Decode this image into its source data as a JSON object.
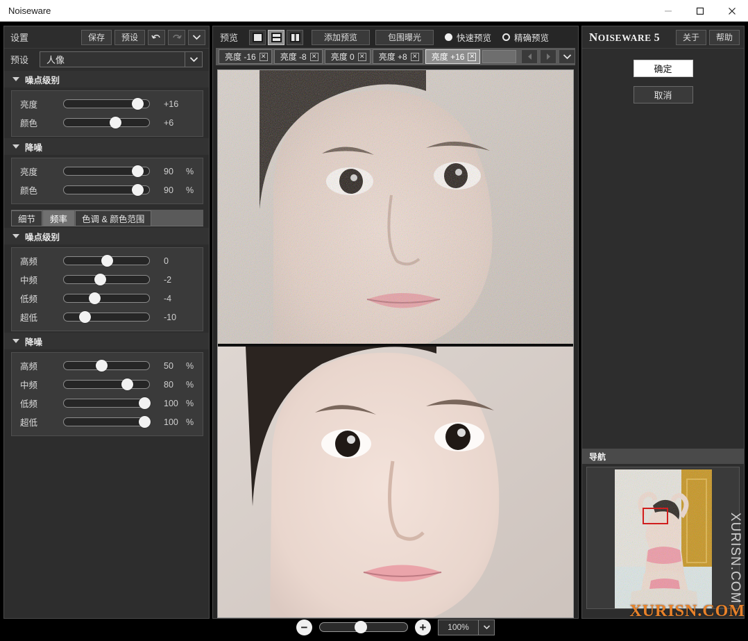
{
  "window": {
    "title": "Noiseware",
    "controls": {
      "minimize": "—",
      "maximize": "□",
      "close": "✕"
    }
  },
  "left_panel": {
    "header": {
      "title": "设置",
      "save_label": "保存",
      "preset_label": "预设",
      "undo_icon": "undo-icon",
      "redo_icon": "redo-icon",
      "menu_icon": "chevron-down-icon"
    },
    "preset": {
      "label": "预设",
      "value": "人像",
      "arrow_icon": "chevron-down-icon"
    },
    "sections": [
      {
        "title": "噪点级别",
        "rows": [
          {
            "name": "亮度",
            "value": "+16",
            "unit": "",
            "pct": 86
          },
          {
            "name": "颜色",
            "value": "+6",
            "unit": "",
            "pct": 60
          }
        ]
      },
      {
        "title": "降噪",
        "rows": [
          {
            "name": "亮度",
            "value": "90",
            "unit": "%",
            "pct": 86
          },
          {
            "name": "颜色",
            "value": "90",
            "unit": "%",
            "pct": 86
          }
        ]
      }
    ],
    "tabs": [
      {
        "label": "细节",
        "selected": false
      },
      {
        "label": "频率",
        "selected": true
      },
      {
        "label": "色调 & 颜色范围",
        "selected": false
      }
    ],
    "freq_sections": [
      {
        "title": "噪点级别",
        "rows": [
          {
            "name": "高频",
            "value": "0",
            "unit": "",
            "pct": 50
          },
          {
            "name": "中频",
            "value": "-2",
            "unit": "",
            "pct": 42
          },
          {
            "name": "低频",
            "value": "-4",
            "unit": "",
            "pct": 36
          },
          {
            "name": "超低",
            "value": "-10",
            "unit": "",
            "pct": 24
          }
        ]
      },
      {
        "title": "降噪",
        "rows": [
          {
            "name": "高频",
            "value": "50",
            "unit": "%",
            "pct": 44
          },
          {
            "name": "中频",
            "value": "80",
            "unit": "%",
            "pct": 74
          },
          {
            "name": "低频",
            "value": "100",
            "unit": "%",
            "pct": 94
          },
          {
            "name": "超低",
            "value": "100",
            "unit": "%",
            "pct": 94
          }
        ]
      }
    ]
  },
  "center_panel": {
    "header": {
      "title": "预览",
      "view_modes": [
        {
          "icon": "single-view-icon",
          "selected": false
        },
        {
          "icon": "horizontal-split-view-icon",
          "selected": true
        },
        {
          "icon": "vertical-split-view-icon",
          "selected": false
        }
      ],
      "add_preview_label": "添加预览",
      "bracket_exposure_label": "包围曝光",
      "quick_preview_label": "快速预览",
      "quick_preview_selected": true,
      "accurate_preview_label": "精确预览",
      "accurate_preview_selected": false
    },
    "preview_tabs": [
      {
        "label": "亮度 -16",
        "close_icon": "close-icon",
        "selected": false
      },
      {
        "label": "亮度 -8",
        "close_icon": "close-icon",
        "selected": false
      },
      {
        "label": "亮度 0",
        "close_icon": "close-icon",
        "selected": false
      },
      {
        "label": "亮度 +8",
        "close_icon": "close-icon",
        "selected": false
      },
      {
        "label": "亮度 +16",
        "close_icon": "close-icon",
        "selected": true
      }
    ],
    "tab_nav": {
      "prev_icon": "triangle-left-icon",
      "next_icon": "triangle-right-icon",
      "list_icon": "chevron-down-icon"
    },
    "zoom_bar": {
      "zoom_out_icon": "minus-circle-icon",
      "zoom_in_icon": "plus-circle-icon",
      "zoom_value": "100%",
      "zoom_arrow_icon": "chevron-down-icon",
      "slider_pct": 40
    }
  },
  "right_panel": {
    "brand": {
      "part1": "N",
      "part2": "OISE",
      "part3": "WARE",
      "version": "5"
    },
    "about_label": "关于",
    "help_label": "帮助",
    "ok_label": "确定",
    "cancel_label": "取消",
    "navigator": {
      "title": "导航"
    }
  },
  "watermark": {
    "vertical": "XURISN.COM",
    "horizontal": "XURISN.COM"
  },
  "colors": {
    "panel_bg": "#2d2d2d",
    "section_bg": "#3a3a3a",
    "accent_white": "#ffffff",
    "selection": "#8d8d8d",
    "nav_marker": "#d01e1e",
    "watermark_orange": "#e8822a"
  }
}
